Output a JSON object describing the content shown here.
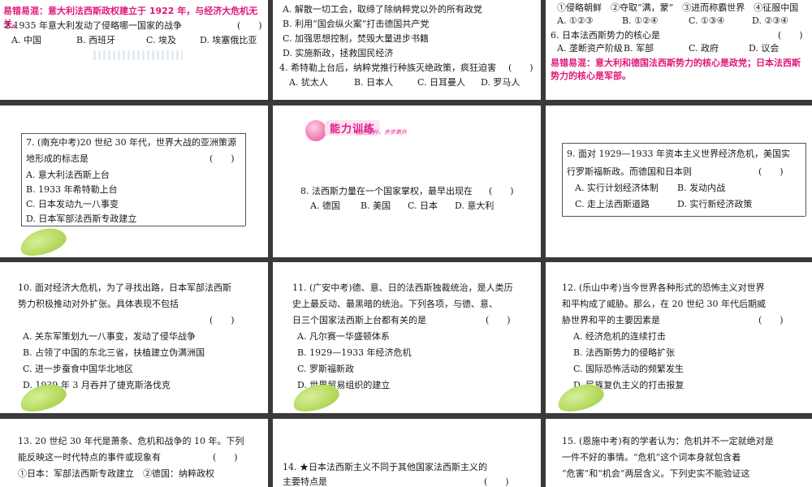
{
  "s1": {
    "note": "易错易混：意大利法西斯政权建立于 1922 年，与经济大危机无关。",
    "q2": "2.1935 年意大利发动了侵略哪一国家的战争",
    "paren": "(　　)",
    "opts": [
      "A. 中国",
      "B. 西班牙",
      "C. 埃及",
      "D. 埃塞俄比亚"
    ]
  },
  "s2": {
    "lines": [
      "A. 解散一切工会，取缔了除纳粹党以外的所有政党",
      "B. 利用“国会纵火案”打击德国共产党",
      "C. 加强思想控制，焚毁大量进步书籍",
      "D. 实施新政，拯救国民经济"
    ],
    "q4": "4. 希特勒上台后，纳粹党推行种族灭绝政策，疯狂迫害",
    "paren": "(　　)",
    "opts": [
      "A. 犹太人",
      "B. 日本人",
      "C. 日耳曼人",
      "D. 罗马人"
    ]
  },
  "s3": {
    "items": "①侵略朝鲜　②夺取“满，蒙”　③进而称霸世界　④征服中国",
    "opts": [
      "A. ①②③",
      "B. ①②④",
      "C. ①③④",
      "D. ②③④"
    ],
    "q6": "6. 日本法西斯势力的核心是",
    "paren": "(　　)",
    "opts6": [
      "A. 垄断资产阶级",
      "B. 军部",
      "C. 政府",
      "D. 议会"
    ],
    "note": "易错易混：意大利和德国法西斯势力的核心是政党；日本法西斯势力的核心是军部。"
  },
  "s4": {
    "lines": [
      "7. (南充中考)20 世纪 30 年代，世界大战的亚洲策源",
      "地形成的标志是"
    ],
    "paren": "(　　)",
    "opts": [
      "A. 意大利法西斯上台",
      "B. 1933 年希特勒上台",
      "C. 日本发动九一八事变",
      "D. 日本军部法西斯专政建立"
    ]
  },
  "s5": {
    "badge_title": "能力训练",
    "badge_sub": "能力提升，步步高升",
    "q8": "8. 法西斯力量在一个国家掌权，最早出现在",
    "paren": "(　　)",
    "opts": [
      "A. 德国",
      "B. 美国",
      "C. 日本",
      "D. 意大利"
    ]
  },
  "s6": {
    "lines": [
      "9. 面对 1929—1933 年资本主义世界经济危机，美国实",
      "行罗斯福新政。而德国和日本则"
    ],
    "paren": "(　　)",
    "opts": [
      "A. 实行计划经济体制",
      "B. 发动内战",
      "C. 走上法西斯道路",
      "D. 实行新经济政策"
    ]
  },
  "s7": {
    "lines": [
      "10. 面对经济大危机，为了寻找出路，日本军部法西斯",
      "势力积极推动对外扩张。具体表现不包括"
    ],
    "paren": "(　　)",
    "opts": [
      "A. 关东军策划九一八事变，发动了侵华战争",
      "B. 占领了中国的东北三省，扶植建立伪满洲国",
      "C. 进一步蚕食中国华北地区",
      "D. 1939 年 3 月吞并了捷克斯洛伐克"
    ]
  },
  "s8": {
    "lines": [
      "11. (广安中考)德、意、日的法西斯独裁统治，是人类历",
      "史上最反动、最黑暗的统治。下列各项，与德、意、",
      "日三个国家法西斯上台都有关的是"
    ],
    "paren": "(　　)",
    "opts": [
      "A. 凡尔赛一华盛顿体系",
      "B. 1929—1933 年经济危机",
      "C. 罗斯福新政",
      "D. 世界贸易组织的建立"
    ]
  },
  "s9": {
    "lines": [
      "12. (乐山中考)当今世界各种形式的恐怖主义对世界",
      "和平构成了威胁。那么，在 20 世纪 30 年代后期威",
      "胁世界和平的主要因素是"
    ],
    "paren": "(　　)",
    "opts": [
      "A. 经济危机的连续打击",
      "B. 法西斯势力的侵略扩张",
      "C. 国际恐怖活动的频繁发生",
      "D. 民族复仇主义的打击报复"
    ]
  },
  "s10": {
    "lines": [
      "13. 20 世纪 30 年代是萧条、危机和战争的 10 年。下列",
      "能反映这一时代特点的事件或现象有",
      "①日本：军部法西斯专政建立　②德国：纳粹政权"
    ],
    "paren": "(　　)"
  },
  "s11": {
    "lines": [
      "14. ★日本法西斯主义不同于其他国家法西斯主义的",
      "主要特点是"
    ],
    "paren": "(　　)"
  },
  "s12": {
    "lines": [
      "15. (恩施中考)有的学者认为：危机并不一定就绝对是",
      "一件不好的事情。“危机”这个词本身就包含着",
      "“危害”和“机会”两层含义。下列史实不能验证这"
    ]
  }
}
